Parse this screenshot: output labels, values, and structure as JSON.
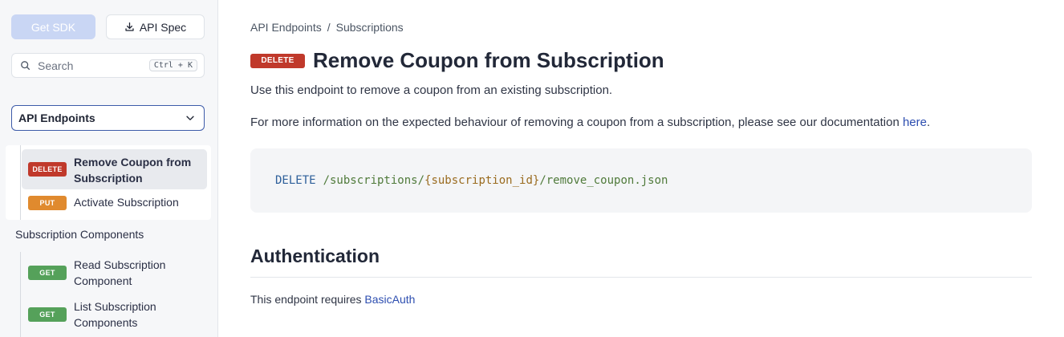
{
  "sidebar": {
    "get_sdk_label": "Get SDK",
    "api_spec_label": "API Spec",
    "search": {
      "placeholder": "Search",
      "shortcut": "Ctrl + K"
    },
    "section_select": {
      "value": "API Endpoints"
    },
    "nav_items": [
      {
        "method": "DELETE",
        "label": "Remove Coupon from Subscription",
        "active": true
      },
      {
        "method": "PUT",
        "label": "Activate Subscription",
        "active": false
      }
    ],
    "group_title": "Subscription Components",
    "group_items": [
      {
        "method": "GET",
        "label": "Read Subscription Component"
      },
      {
        "method": "GET",
        "label": "List Subscription Components"
      }
    ]
  },
  "main": {
    "breadcrumb": [
      "API Endpoints",
      "Subscriptions"
    ],
    "breadcrumb_separator": "/",
    "method": "DELETE",
    "title": "Remove Coupon from Subscription",
    "description": "Use this endpoint to remove a coupon from an existing subscription.",
    "more_info_text": "For more information on the expected behaviour of removing a coupon from a subscription, please see our documentation",
    "more_info_link": "here",
    "more_info_suffix": ".",
    "endpoint": {
      "method": "DELETE",
      "path_prefix": "/subscriptions/",
      "path_param": "{subscription_id}",
      "path_suffix": "/remove_coupon.json"
    },
    "auth_heading": "Authentication",
    "auth_text": "This endpoint requires",
    "auth_link": "BasicAuth"
  },
  "colors": {
    "delete": "#c0392b",
    "put": "#e08a2e",
    "get": "#55a15a",
    "link": "#2d4eb0",
    "accent_border": "#3d5ba9"
  },
  "icons": [
    "download-icon",
    "search-icon",
    "chevron-down-icon"
  ]
}
